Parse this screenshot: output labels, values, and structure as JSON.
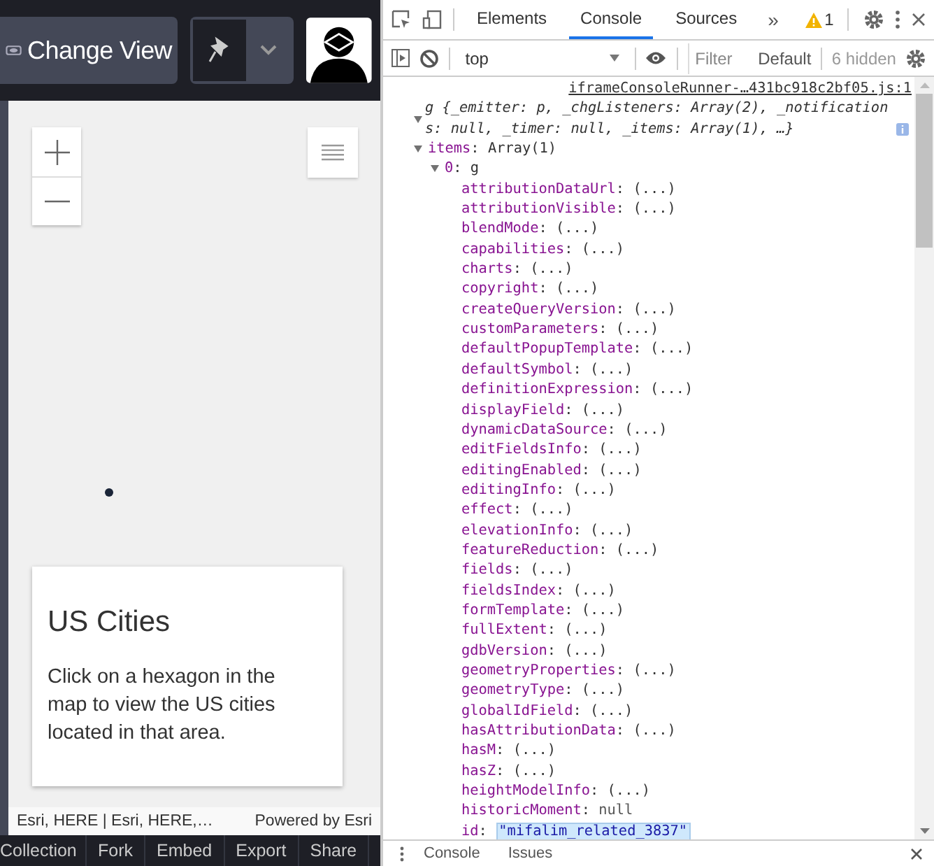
{
  "app_bar": {
    "change_view_button": "Change View",
    "pin_selected": true
  },
  "map": {
    "legend": {
      "title": "US Cities",
      "description": "Click on a hexagon in the map to view the US cities located in that area."
    },
    "attribution": "Esri, HERE | Esri, HERE,…",
    "powered_by": "Powered by Esri"
  },
  "footer_buttons": [
    "Collection",
    "Fork",
    "Embed",
    "Export",
    "Share"
  ],
  "devtools": {
    "tabs": [
      {
        "label": "Elements",
        "selected": false
      },
      {
        "label": "Console",
        "selected": true
      },
      {
        "label": "Sources",
        "selected": false
      }
    ],
    "more_tabs": "»",
    "warning_count": "1",
    "context": "top",
    "filter": {
      "placeholder": "Filter"
    },
    "levels": "Default",
    "hidden_count": "6 hidden",
    "console": {
      "key_separator": ":",
      "source": "iframeConsoleRunner-…431bc918c2bf05.js:1",
      "summary": "g {_emitter: p, _chgListeners: Array(2), _notifications: null, _timer: null, _items: Array(1), …}",
      "tree": {
        "key": "items",
        "value": "Array(1)",
        "expanded": true,
        "children": [
          {
            "key": "0",
            "value": "g",
            "expanded": true,
            "children": [
              {
                "key": "attributionDataUrl",
                "value": "(...)",
                "kind": "getter",
                "selected": false
              },
              {
                "key": "attributionVisible",
                "value": "(...)",
                "kind": "getter",
                "selected": false
              },
              {
                "key": "blendMode",
                "value": "(...)",
                "kind": "getter",
                "selected": false
              },
              {
                "key": "capabilities",
                "value": "(...)",
                "kind": "getter",
                "selected": false
              },
              {
                "key": "charts",
                "value": "(...)",
                "kind": "getter",
                "selected": false
              },
              {
                "key": "copyright",
                "value": "(...)",
                "kind": "getter",
                "selected": false
              },
              {
                "key": "createQueryVersion",
                "value": "(...)",
                "kind": "getter",
                "selected": false
              },
              {
                "key": "customParameters",
                "value": "(...)",
                "kind": "getter",
                "selected": false
              },
              {
                "key": "defaultPopupTemplate",
                "value": "(...)",
                "kind": "getter",
                "selected": false
              },
              {
                "key": "defaultSymbol",
                "value": "(...)",
                "kind": "getter",
                "selected": false
              },
              {
                "key": "definitionExpression",
                "value": "(...)",
                "kind": "getter",
                "selected": false
              },
              {
                "key": "displayField",
                "value": "(...)",
                "kind": "getter",
                "selected": false
              },
              {
                "key": "dynamicDataSource",
                "value": "(...)",
                "kind": "getter",
                "selected": false
              },
              {
                "key": "editFieldsInfo",
                "value": "(...)",
                "kind": "getter",
                "selected": false
              },
              {
                "key": "editingEnabled",
                "value": "(...)",
                "kind": "getter",
                "selected": false
              },
              {
                "key": "editingInfo",
                "value": "(...)",
                "kind": "getter",
                "selected": false
              },
              {
                "key": "effect",
                "value": "(...)",
                "kind": "getter",
                "selected": false
              },
              {
                "key": "elevationInfo",
                "value": "(...)",
                "kind": "getter",
                "selected": false
              },
              {
                "key": "featureReduction",
                "value": "(...)",
                "kind": "getter",
                "selected": false
              },
              {
                "key": "fields",
                "value": "(...)",
                "kind": "getter",
                "selected": false
              },
              {
                "key": "fieldsIndex",
                "value": "(...)",
                "kind": "getter",
                "selected": false
              },
              {
                "key": "formTemplate",
                "value": "(...)",
                "kind": "getter",
                "selected": false
              },
              {
                "key": "fullExtent",
                "value": "(...)",
                "kind": "getter",
                "selected": false
              },
              {
                "key": "gdbVersion",
                "value": "(...)",
                "kind": "getter",
                "selected": false
              },
              {
                "key": "geometryProperties",
                "value": "(...)",
                "kind": "getter",
                "selected": false
              },
              {
                "key": "geometryType",
                "value": "(...)",
                "kind": "getter",
                "selected": false
              },
              {
                "key": "globalIdField",
                "value": "(...)",
                "kind": "getter",
                "selected": false
              },
              {
                "key": "hasAttributionData",
                "value": "(...)",
                "kind": "getter",
                "selected": false
              },
              {
                "key": "hasM",
                "value": "(...)",
                "kind": "getter",
                "selected": false
              },
              {
                "key": "hasZ",
                "value": "(...)",
                "kind": "getter",
                "selected": false
              },
              {
                "key": "heightModelInfo",
                "value": "(...)",
                "kind": "getter",
                "selected": false
              },
              {
                "key": "historicMoment",
                "value": "null",
                "kind": "null",
                "selected": false
              },
              {
                "key": "id",
                "value": "\"mifalim_related_3837\"",
                "kind": "string",
                "selected": true
              }
            ]
          }
        ]
      }
    }
  },
  "drawer_tabs": [
    {
      "label": "Console",
      "selected": false
    },
    {
      "label": "Issues",
      "selected": false
    }
  ]
}
